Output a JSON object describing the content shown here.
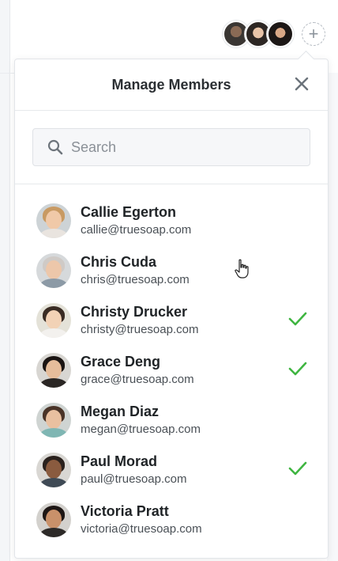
{
  "panel": {
    "title": "Manage Members"
  },
  "search": {
    "placeholder": "Search",
    "value": ""
  },
  "members": [
    {
      "name": "Callie Egerton",
      "email": "callie@truesoap.com",
      "selected": false
    },
    {
      "name": "Chris Cuda",
      "email": "chris@truesoap.com",
      "selected": false
    },
    {
      "name": "Christy Drucker",
      "email": "christy@truesoap.com",
      "selected": true
    },
    {
      "name": "Grace Deng",
      "email": "grace@truesoap.com",
      "selected": true
    },
    {
      "name": "Megan Diaz",
      "email": "megan@truesoap.com",
      "selected": false
    },
    {
      "name": "Paul Morad",
      "email": "paul@truesoap.com",
      "selected": true
    },
    {
      "name": "Victoria Pratt",
      "email": "victoria@truesoap.com",
      "selected": false
    }
  ],
  "colors": {
    "check": "#3fb541",
    "title_text": "#2b2f33",
    "panel_border": "#e2e5e9"
  },
  "icons": {
    "close": "close-icon",
    "search": "search-icon",
    "check": "check-icon",
    "add": "add-member-icon"
  }
}
